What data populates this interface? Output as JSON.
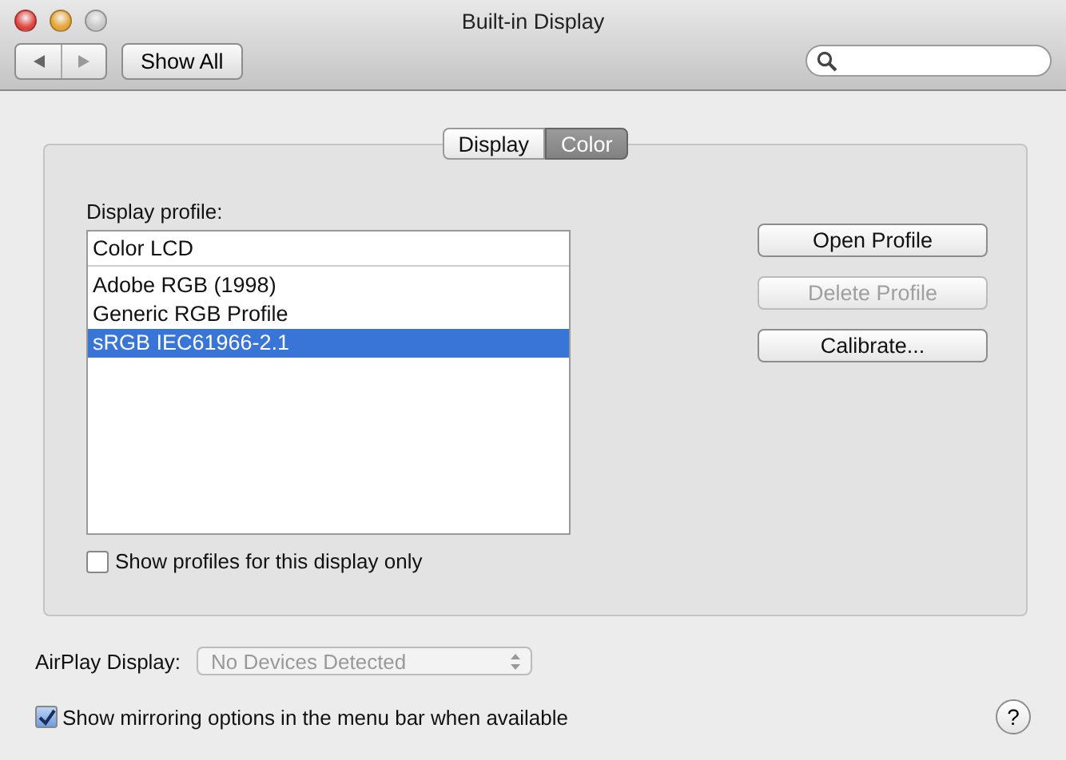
{
  "window": {
    "title": "Built-in Display",
    "controls": [
      {
        "kind": "close"
      },
      {
        "kind": "minimize"
      },
      {
        "kind": "zoom"
      }
    ]
  },
  "toolbar": {
    "show_all": "Show All"
  },
  "tabs": [
    {
      "label": "Display",
      "selected": false
    },
    {
      "label": "Color",
      "selected": true
    }
  ],
  "profile_label": "Display profile:",
  "profiles": [
    {
      "name": "Color LCD",
      "kind": "current",
      "selected": false
    },
    {
      "name": "Adobe RGB (1998)",
      "kind": "profile",
      "selected": false
    },
    {
      "name": "Generic RGB Profile",
      "kind": "profile",
      "selected": false
    },
    {
      "name": "sRGB IEC61966-2.1",
      "kind": "profile",
      "selected": true
    }
  ],
  "buttons": [
    {
      "label": "Open Profile",
      "disabled": false
    },
    {
      "label": "Delete Profile",
      "disabled": true
    },
    {
      "label": "Calibrate...",
      "disabled": false
    }
  ],
  "only_this_display": {
    "label": "Show profiles for this display only",
    "checked": false
  },
  "airplay": {
    "label": "AirPlay Display:",
    "value": "No Devices Detected",
    "disabled": true
  },
  "mirroring": {
    "label": "Show mirroring options in the menu bar when available",
    "checked": true
  },
  "help": "?"
}
